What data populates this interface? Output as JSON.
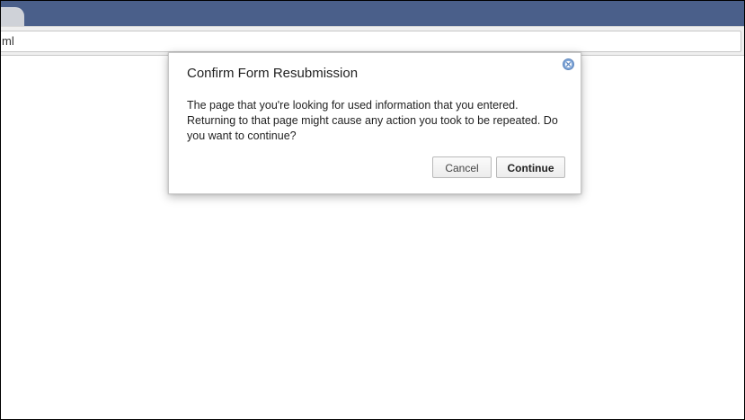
{
  "browser": {
    "url_fragment": "ml"
  },
  "dialog": {
    "title": "Confirm Form Resubmission",
    "message": "The page that you're looking for used information that you entered. Returning to that page might cause any action you took to be repeated. Do you want to continue?",
    "cancel_label": "Cancel",
    "continue_label": "Continue",
    "close_icon": "close-icon"
  },
  "colors": {
    "tabstrip": "#4a5f8a",
    "close_icon": "#7fa6d8"
  }
}
